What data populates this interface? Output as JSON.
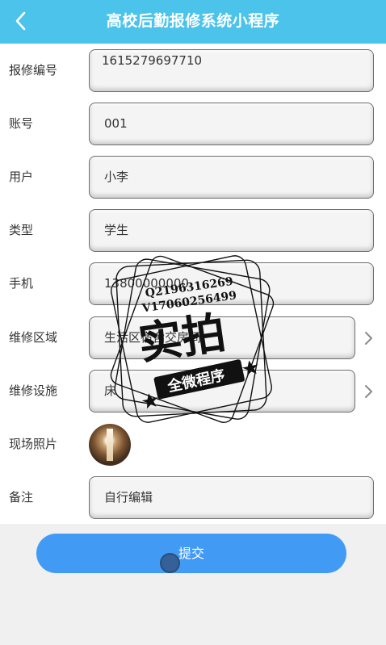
{
  "nav": {
    "title": "高校后勤报修系统小程序",
    "back_icon": "chevron-left-icon"
  },
  "form": {
    "repair_no": {
      "label": "报修编号",
      "value": "1615279697710"
    },
    "account": {
      "label": "账号",
      "value": "001"
    },
    "user": {
      "label": "用户",
      "value": "小李"
    },
    "type": {
      "label": "类型",
      "value": "学生"
    },
    "phone": {
      "label": "手机",
      "value": "13800000000"
    },
    "area": {
      "label": "维修区域",
      "value": "生活区宿舍交房间"
    },
    "facility": {
      "label": "维修设施",
      "value": "床"
    },
    "photo": {
      "label": "现场照片"
    },
    "remark": {
      "label": "备注",
      "value": "自行编辑"
    }
  },
  "submit_label": "提交",
  "watermark": {
    "line1": "Q2196316269",
    "line2": "V17060256499",
    "big_text": "实拍",
    "banner_text": "全微程序"
  },
  "colors": {
    "nav_bg": "#4bc3ea",
    "submit_bg": "#419bf5",
    "page_bg": "#f0f0f0"
  }
}
